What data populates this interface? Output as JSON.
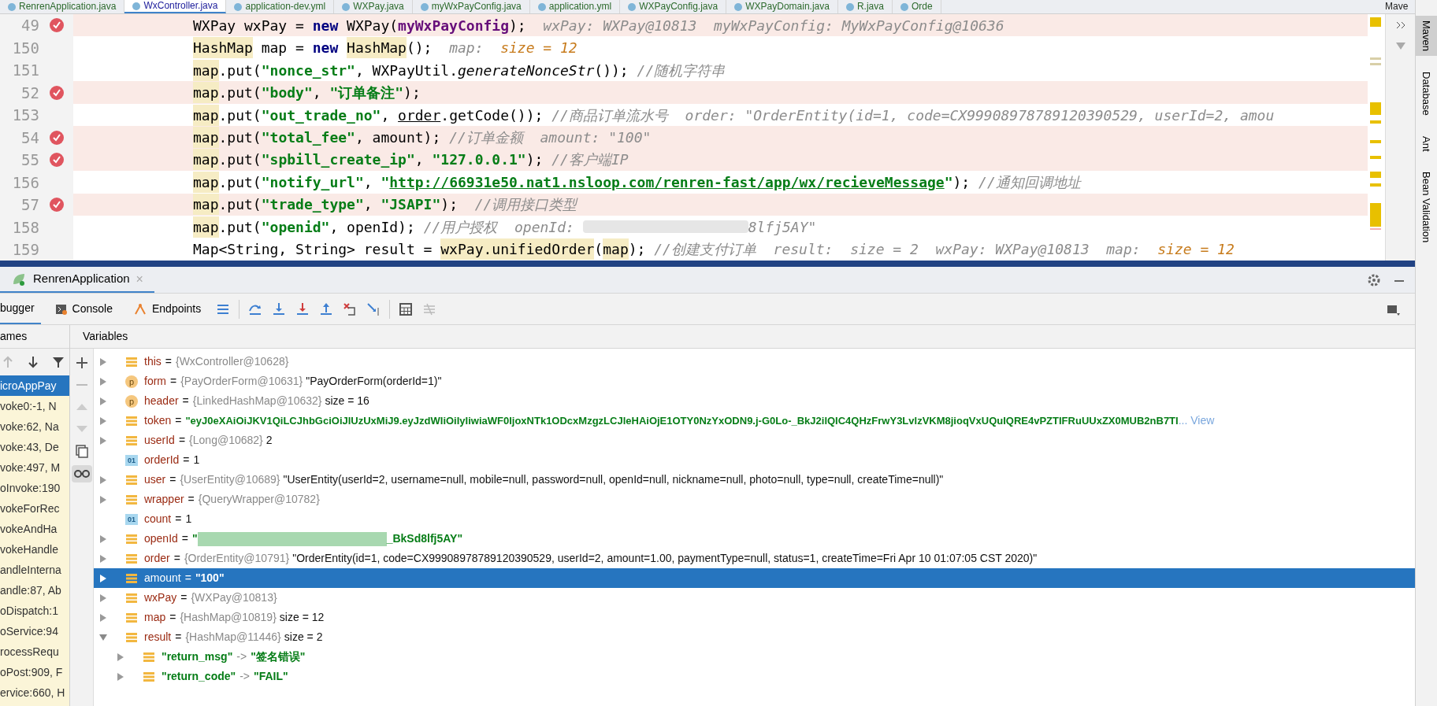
{
  "editor_tabs": [
    {
      "label": "RenrenApplication.java",
      "selected": false
    },
    {
      "label": "WxController.java",
      "selected": true
    },
    {
      "label": "application-dev.yml",
      "selected": false
    },
    {
      "label": "WXPay.java",
      "selected": false
    },
    {
      "label": "myWxPayConfig.java",
      "selected": false
    },
    {
      "label": "application.yml",
      "selected": false
    },
    {
      "label": "WXPayConfig.java",
      "selected": false
    },
    {
      "label": "WXPayDomain.java",
      "selected": false
    },
    {
      "label": "R.java",
      "selected": false
    },
    {
      "label": "Orde",
      "selected": false
    }
  ],
  "tool_window_title": "Mave",
  "code_lines": [
    {
      "number": "49",
      "breakpoint": true,
      "segments": [
        {
          "kind": "text",
          "text": "WXPay wxPay = "
        },
        {
          "kind": "keyword",
          "text": "new"
        },
        {
          "kind": "text",
          "text": " WXPay("
        },
        {
          "kind": "field",
          "text": "myWxPayConfig"
        },
        {
          "kind": "text",
          "text": ");  "
        },
        {
          "kind": "hint",
          "text": "wxPay: WXPay@10813  myWxPayConfig: MyWxPayConfig@10636"
        }
      ]
    },
    {
      "number": "150",
      "breakpoint": false,
      "segments": [
        {
          "kind": "mark",
          "text": "HashMap"
        },
        {
          "kind": "text",
          "text": " map = "
        },
        {
          "kind": "keyword",
          "text": "new "
        },
        {
          "kind": "mark",
          "text": "HashMap"
        },
        {
          "kind": "text",
          "text": "();  "
        },
        {
          "kind": "hint",
          "text": "map:  "
        },
        {
          "kind": "hint_value",
          "text": "size = 12"
        }
      ]
    },
    {
      "number": "151",
      "breakpoint": false,
      "segments": [
        {
          "kind": "mark",
          "text": "map"
        },
        {
          "kind": "text",
          "text": ".put("
        },
        {
          "kind": "string",
          "text": "\"nonce_str\""
        },
        {
          "kind": "text",
          "text": ", WXPayUtil."
        },
        {
          "kind": "method",
          "text": "generateNonceStr"
        },
        {
          "kind": "text",
          "text": "()); "
        },
        {
          "kind": "comment",
          "text": "//随机字符串"
        }
      ]
    },
    {
      "number": "52",
      "breakpoint": true,
      "segments": [
        {
          "kind": "mark",
          "text": "map"
        },
        {
          "kind": "text",
          "text": ".put("
        },
        {
          "kind": "string",
          "text": "\"body\""
        },
        {
          "kind": "text",
          "text": ", "
        },
        {
          "kind": "string",
          "text": "\"订单备注\""
        },
        {
          "kind": "text",
          "text": ");"
        }
      ]
    },
    {
      "number": "153",
      "breakpoint": false,
      "segments": [
        {
          "kind": "mark",
          "text": "map"
        },
        {
          "kind": "text",
          "text": ".put("
        },
        {
          "kind": "string",
          "text": "\"out_trade_no\""
        },
        {
          "kind": "text",
          "text": ", "
        },
        {
          "kind": "underline",
          "text": "order"
        },
        {
          "kind": "text",
          "text": ".getCode()); "
        },
        {
          "kind": "comment",
          "text": "//商品订单流水号"
        },
        {
          "kind": "hint",
          "text": "  order: \"OrderEntity(id=1, code=CX99908978789120390529, userId=2, amou"
        }
      ]
    },
    {
      "number": "54",
      "breakpoint": true,
      "segments": [
        {
          "kind": "mark",
          "text": "map"
        },
        {
          "kind": "text",
          "text": ".put("
        },
        {
          "kind": "string",
          "text": "\"total_fee\""
        },
        {
          "kind": "text",
          "text": ", amount); "
        },
        {
          "kind": "comment",
          "text": "//订单金额"
        },
        {
          "kind": "hint",
          "text": "  amount: \"100\""
        }
      ]
    },
    {
      "number": "55",
      "breakpoint": true,
      "segments": [
        {
          "kind": "mark",
          "text": "map"
        },
        {
          "kind": "text",
          "text": ".put("
        },
        {
          "kind": "string",
          "text": "\"spbill_create_ip\""
        },
        {
          "kind": "text",
          "text": ", "
        },
        {
          "kind": "string",
          "text": "\"127.0.0.1\""
        },
        {
          "kind": "text",
          "text": "); "
        },
        {
          "kind": "comment",
          "text": "//客户端IP"
        }
      ]
    },
    {
      "number": "156",
      "breakpoint": false,
      "segments": [
        {
          "kind": "mark",
          "text": "map"
        },
        {
          "kind": "text",
          "text": ".put("
        },
        {
          "kind": "string",
          "text": "\"notify_url\""
        },
        {
          "kind": "text",
          "text": ", "
        },
        {
          "kind": "string",
          "text": "\""
        },
        {
          "kind": "link",
          "text": "http://66931e50.nat1.nsloop.com/renren-fast/app/wx/recieveMessage"
        },
        {
          "kind": "string",
          "text": "\""
        },
        {
          "kind": "text",
          "text": "); "
        },
        {
          "kind": "comment",
          "text": "//通知回调地址"
        }
      ]
    },
    {
      "number": "57",
      "breakpoint": true,
      "segments": [
        {
          "kind": "mark",
          "text": "map"
        },
        {
          "kind": "text",
          "text": ".put("
        },
        {
          "kind": "string",
          "text": "\"trade_type\""
        },
        {
          "kind": "text",
          "text": ", "
        },
        {
          "kind": "string",
          "text": "\"JSAPI\""
        },
        {
          "kind": "text",
          "text": ");  "
        },
        {
          "kind": "comment",
          "text": "//调用接口类型"
        }
      ]
    },
    {
      "number": "158",
      "breakpoint": false,
      "segments": [
        {
          "kind": "mark",
          "text": "map"
        },
        {
          "kind": "text",
          "text": ".put("
        },
        {
          "kind": "string",
          "text": "\"openid\""
        },
        {
          "kind": "text",
          "text": ", openId); "
        },
        {
          "kind": "comment",
          "text": "//用户授权"
        },
        {
          "kind": "hint",
          "text": "  openId: "
        },
        {
          "kind": "redacted"
        },
        {
          "kind": "hint",
          "text": "8lfj5AY\""
        }
      ]
    },
    {
      "number": "159",
      "breakpoint": false,
      "segments": [
        {
          "kind": "text",
          "text": "Map<String, String> result = "
        },
        {
          "kind": "mark",
          "text": "wxPay.unifiedOrder"
        },
        {
          "kind": "text",
          "text": "("
        },
        {
          "kind": "mark",
          "text": "map"
        },
        {
          "kind": "text",
          "text": "); "
        },
        {
          "kind": "comment",
          "text": "//创建支付订单"
        },
        {
          "kind": "hint",
          "text": "  result:  size = 2  wxPay: WXPay@10813  map:  "
        },
        {
          "kind": "hint_value",
          "text": "size = 12"
        }
      ]
    }
  ],
  "debug_session": {
    "label": "RenrenApplication",
    "close": "×"
  },
  "debug_tabs": [
    {
      "label": "bugger",
      "selected": true
    },
    {
      "label": "Console",
      "selected": false
    },
    {
      "label": "Endpoints",
      "selected": false
    }
  ],
  "frames": {
    "header": "ames",
    "items": [
      {
        "text": "icroAppPay",
        "selected": true
      },
      {
        "text": "voke0:-1, N",
        "selected": false
      },
      {
        "text": "voke:62, Na",
        "selected": false
      },
      {
        "text": "voke:43, De",
        "selected": false
      },
      {
        "text": "voke:497, M",
        "selected": false
      },
      {
        "text": "oInvoke:190",
        "selected": false
      },
      {
        "text": "vokeForRec",
        "selected": false
      },
      {
        "text": "vokeAndHa",
        "selected": false
      },
      {
        "text": "vokeHandle",
        "selected": false
      },
      {
        "text": "andleInterna",
        "selected": false
      },
      {
        "text": "andle:87, Ab",
        "selected": false
      },
      {
        "text": "oDispatch:1",
        "selected": false
      },
      {
        "text": "oService:94",
        "selected": false
      },
      {
        "text": "rocessRequ",
        "selected": false
      },
      {
        "text": "oPost:909, F",
        "selected": false
      },
      {
        "text": "ervice:660, H",
        "selected": false
      }
    ]
  },
  "variables": {
    "header": "Variables",
    "items": [
      {
        "kind": "field",
        "name": "this",
        "operator": "=",
        "type_ref": "{WxController@10628}",
        "expanded": false,
        "selected": false
      },
      {
        "kind": "param",
        "badge": "p",
        "name": "form",
        "operator": "=",
        "type_ref": "{PayOrderForm@10631}",
        "summary": "\"PayOrderForm(orderId=1)\"",
        "expanded": false,
        "selected": false
      },
      {
        "kind": "param",
        "badge": "p",
        "name": "header",
        "operator": "=",
        "type_ref": "{LinkedHashMap@10632}",
        "summary": " size = 16",
        "expanded": false,
        "selected": false
      },
      {
        "kind": "field",
        "name": "token",
        "operator": "=",
        "string_value": "\"eyJ0eXAiOiJKV1QiLCJhbGciOiJIUzUxMiJ9.eyJzdWIiOiIyIiwiaWF0IjoxNTk1ODcxMzgzLCJleHAiOjE1OTY0NzYxODN9.j-G0Lo-_BkJ2ilQIC4QHzFrwY3LvlzVKM8jioqVxUQuIQRE4vPZTIFRuUUxZX0MUB2nB7TI",
        "view_link": "... View",
        "expanded": false,
        "selected": false
      },
      {
        "kind": "field",
        "name": "userId",
        "operator": "=",
        "type_ref": "{Long@10682}",
        "summary": "2",
        "expanded": false,
        "selected": false
      },
      {
        "kind": "primitive",
        "badge": "01",
        "name": "orderId",
        "operator": "=",
        "summary": "1",
        "selected": false
      },
      {
        "kind": "field",
        "name": "user",
        "operator": "=",
        "type_ref": "{UserEntity@10689}",
        "summary": "\"UserEntity(userId=2, username=null, mobile=null, password=null, openId=null, nickname=null, photo=null, type=null, createTime=null)\"",
        "expanded": false,
        "selected": false
      },
      {
        "kind": "field",
        "name": "wrapper",
        "operator": "=",
        "type_ref": "{QueryWrapper@10782}",
        "expanded": false,
        "selected": false
      },
      {
        "kind": "primitive",
        "badge": "01",
        "name": "count",
        "operator": "=",
        "summary": "1",
        "selected": false
      },
      {
        "kind": "field",
        "name": "openId",
        "operator": "=",
        "string_value": "\"",
        "redacted": true,
        "string_tail": "_BkSd8lfj5AY\"",
        "expanded": false,
        "selected": false
      },
      {
        "kind": "field",
        "name": "order",
        "operator": "=",
        "type_ref": "{OrderEntity@10791}",
        "summary": "\"OrderEntity(id=1, code=CX99908978789120390529, userId=2, amount=1.00, paymentType=null, status=1, createTime=Fri Apr 10 01:07:05 CST 2020)\"",
        "expanded": false,
        "selected": false
      },
      {
        "kind": "field",
        "name": "amount",
        "operator": "=",
        "string_value": "\"100\"",
        "expanded": false,
        "selected": true
      },
      {
        "kind": "field",
        "name": "wxPay",
        "operator": "=",
        "type_ref": "{WXPay@10813}",
        "expanded": false,
        "selected": false
      },
      {
        "kind": "field",
        "name": "map",
        "operator": "=",
        "type_ref": "{HashMap@10819}",
        "summary": " size = 12",
        "expanded": false,
        "selected": false
      },
      {
        "kind": "field",
        "name": "result",
        "operator": "=",
        "type_ref": "{HashMap@11446}",
        "summary": " size = 2",
        "expanded": true,
        "selected": false,
        "children": [
          {
            "kind": "entry",
            "key": "\"return_msg\"",
            "arrow": "->",
            "string_value": "\"签名错误\"",
            "expanded": false,
            "selected": false
          },
          {
            "kind": "entry",
            "key": "\"return_code\"",
            "arrow": "->",
            "string_value": "\"FAIL\"",
            "expanded": false,
            "selected": false
          }
        ]
      }
    ]
  },
  "side_tools": [
    {
      "label": "Maven",
      "selected": true
    },
    {
      "label": "Database",
      "selected": false
    },
    {
      "label": "Ant",
      "selected": false
    },
    {
      "label": "Bean Validation",
      "selected": false
    }
  ]
}
